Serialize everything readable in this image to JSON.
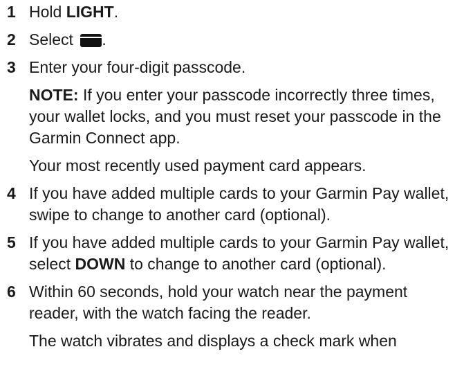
{
  "steps": [
    {
      "num": "1",
      "pre": "Hold ",
      "bold": "LIGHT",
      "post": "."
    },
    {
      "num": "2",
      "pre": "Select ",
      "icon": "wallet-card-icon",
      "post": "."
    },
    {
      "num": "3",
      "text": "Enter your four-digit passcode.",
      "note_label": "NOTE:",
      "note_text": " If you enter your passcode incorrectly three times, your wallet locks, and you must reset your passcode in the Garmin Connect app.",
      "result": "Your most recently used payment card appears."
    },
    {
      "num": "4",
      "text": "If you have added multiple cards to your Garmin Pay wallet, swipe to change to another card (optional)."
    },
    {
      "num": "5",
      "pre": "If you have added multiple cards to your Garmin Pay wallet, select ",
      "bold": "DOWN",
      "post": " to change to another card (optional)."
    },
    {
      "num": "6",
      "text": "Within 60 seconds, hold your watch near the payment reader, with the watch facing the reader.",
      "result": "The watch vibrates and displays a check mark when"
    }
  ]
}
